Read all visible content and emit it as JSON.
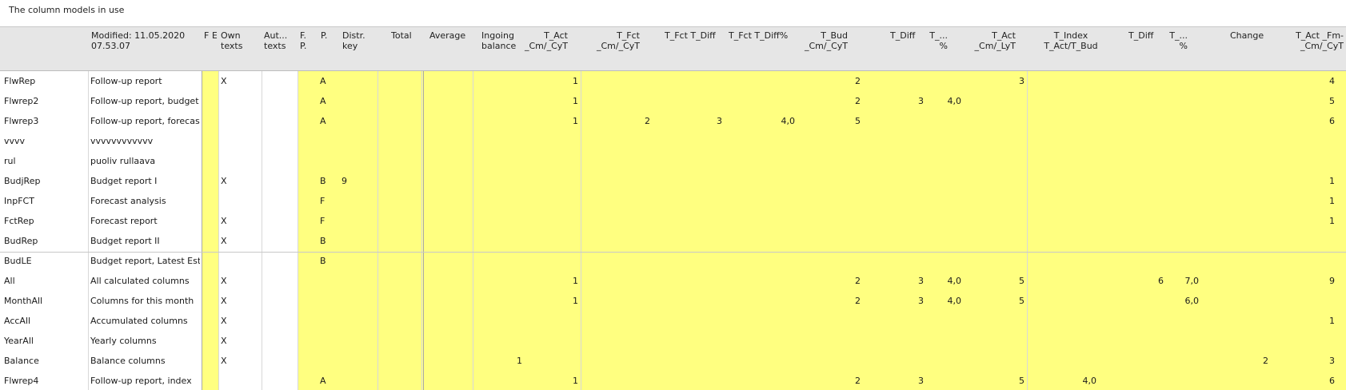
{
  "title": "The column models in use",
  "colors": {
    "highlight": "#ffff80",
    "header_bg": "#e6e6e6",
    "row_line": "#c8c8c8"
  },
  "header": {
    "modified": "Modified: 11.05.2020\n07.53.07",
    "f": "F",
    "e": "E",
    "own_texts": "Own\ntexts",
    "aut_texts": "Aut...\ntexts",
    "fp": "F.\nP.",
    "p": "P.",
    "distr_key": "Distr.\nkey",
    "total": "Total",
    "average": "Average",
    "ingoing_balance": "Ingoing\nbalance",
    "t_act_cm_cyt": "T_Act\n_Cm/_CyT",
    "t_fct_cm_cyt": "T_Fct\n_Cm/_CyT",
    "t_fct_t_diff": "T_Fct T_Diff",
    "t_fct_t_diff_pct": "T_Fct T_Diff%",
    "t_bud_cm_cyt": "T_Bud\n_Cm/_CyT",
    "t_diff_1": "T_Diff",
    "t_pct_1": "T_...\n%",
    "t_act_cm_lyt": "T_Act\n_Cm/_LyT",
    "t_index": "T_Index\nT_Act/T_Bud",
    "t_diff_2": "T_Diff",
    "t_pct_2": "T_...\n%",
    "change": "Change",
    "t_act_fm": "T_Act _Fm-\n_Cm/_CyT"
  },
  "rows": [
    {
      "code": "FlwRep",
      "name": "Follow-up report",
      "own": "X",
      "p": "A",
      "distr": "",
      "ingoing": "",
      "t_act": "1",
      "t_fct": "",
      "fct_diff": "",
      "fct_diff_pct": "",
      "t_bud": "2",
      "t_diff1": "",
      "t_pct1": "",
      "t_act_ly": "3",
      "t_index": "",
      "t_diff2": "",
      "t_pct2": "",
      "change": "",
      "t_act_fm": "4"
    },
    {
      "code": "Flwrep2",
      "name": "Follow-up report, budget",
      "own": "",
      "p": "A",
      "distr": "",
      "ingoing": "",
      "t_act": "1",
      "t_fct": "",
      "fct_diff": "",
      "fct_diff_pct": "",
      "t_bud": "2",
      "t_diff1": "3",
      "t_pct1": "4,0",
      "t_act_ly": "",
      "t_index": "",
      "t_diff2": "",
      "t_pct2": "",
      "change": "",
      "t_act_fm": "5"
    },
    {
      "code": "Flwrep3",
      "name": "Follow-up report, forecast",
      "own": "",
      "p": "A",
      "distr": "",
      "ingoing": "",
      "t_act": "1",
      "t_fct": "2",
      "fct_diff": "3",
      "fct_diff_pct": "4,0",
      "t_bud": "5",
      "t_diff1": "",
      "t_pct1": "",
      "t_act_ly": "",
      "t_index": "",
      "t_diff2": "",
      "t_pct2": "",
      "change": "",
      "t_act_fm": "6"
    },
    {
      "code": "vvvv",
      "name": "vvvvvvvvvvvv",
      "own": "",
      "p": "",
      "distr": "",
      "ingoing": "",
      "t_act": "",
      "t_fct": "",
      "fct_diff": "",
      "fct_diff_pct": "",
      "t_bud": "",
      "t_diff1": "",
      "t_pct1": "",
      "t_act_ly": "",
      "t_index": "",
      "t_diff2": "",
      "t_pct2": "",
      "change": "",
      "t_act_fm": ""
    },
    {
      "code": "rul",
      "name": "puoliv rullaava",
      "own": "",
      "p": "",
      "distr": "",
      "ingoing": "",
      "t_act": "",
      "t_fct": "",
      "fct_diff": "",
      "fct_diff_pct": "",
      "t_bud": "",
      "t_diff1": "",
      "t_pct1": "",
      "t_act_ly": "",
      "t_index": "",
      "t_diff2": "",
      "t_pct2": "",
      "change": "",
      "t_act_fm": ""
    },
    {
      "code": "BudjRep",
      "name": "Budget report I",
      "own": "X",
      "p": "B",
      "distr": "9",
      "ingoing": "",
      "t_act": "",
      "t_fct": "",
      "fct_diff": "",
      "fct_diff_pct": "",
      "t_bud": "",
      "t_diff1": "",
      "t_pct1": "",
      "t_act_ly": "",
      "t_index": "",
      "t_diff2": "",
      "t_pct2": "",
      "change": "",
      "t_act_fm": "1"
    },
    {
      "code": "InpFCT",
      "name": "Forecast analysis",
      "own": "",
      "p": "F",
      "distr": "",
      "ingoing": "",
      "t_act": "",
      "t_fct": "",
      "fct_diff": "",
      "fct_diff_pct": "",
      "t_bud": "",
      "t_diff1": "",
      "t_pct1": "",
      "t_act_ly": "",
      "t_index": "",
      "t_diff2": "",
      "t_pct2": "",
      "change": "",
      "t_act_fm": "1"
    },
    {
      "code": "FctRep",
      "name": "Forecast report",
      "own": "X",
      "p": "F",
      "distr": "",
      "ingoing": "",
      "t_act": "",
      "t_fct": "",
      "fct_diff": "",
      "fct_diff_pct": "",
      "t_bud": "",
      "t_diff1": "",
      "t_pct1": "",
      "t_act_ly": "",
      "t_index": "",
      "t_diff2": "",
      "t_pct2": "",
      "change": "",
      "t_act_fm": "1"
    },
    {
      "code": "BudRep",
      "name": "Budget report II",
      "own": "X",
      "p": "B",
      "distr": "",
      "ingoing": "",
      "t_act": "",
      "t_fct": "",
      "fct_diff": "",
      "fct_diff_pct": "",
      "t_bud": "",
      "t_diff1": "",
      "t_pct1": "",
      "t_act_ly": "",
      "t_index": "",
      "t_diff2": "",
      "t_pct2": "",
      "change": "",
      "t_act_fm": ""
    },
    {
      "code": "BudLE",
      "name": "Budget report, Latest Esti...",
      "own": "",
      "p": "B",
      "distr": "",
      "ingoing": "",
      "t_act": "",
      "t_fct": "",
      "fct_diff": "",
      "fct_diff_pct": "",
      "t_bud": "",
      "t_diff1": "",
      "t_pct1": "",
      "t_act_ly": "",
      "t_index": "",
      "t_diff2": "",
      "t_pct2": "",
      "change": "",
      "t_act_fm": ""
    },
    {
      "code": "All",
      "name": "All calculated columns",
      "own": "X",
      "p": "",
      "distr": "",
      "ingoing": "",
      "t_act": "1",
      "t_fct": "",
      "fct_diff": "",
      "fct_diff_pct": "",
      "t_bud": "2",
      "t_diff1": "3",
      "t_pct1": "4,0",
      "t_act_ly": "5",
      "t_index": "",
      "t_diff2": "6",
      "t_pct2": "7,0",
      "change": "",
      "t_act_fm": "9"
    },
    {
      "code": "MonthAll",
      "name": "Columns for this month",
      "own": "X",
      "p": "",
      "distr": "",
      "ingoing": "",
      "t_act": "1",
      "t_fct": "",
      "fct_diff": "",
      "fct_diff_pct": "",
      "t_bud": "2",
      "t_diff1": "3",
      "t_pct1": "4,0",
      "t_act_ly": "5",
      "t_index": "",
      "t_diff2": "",
      "t_pct2": "6,0",
      "change": "",
      "t_act_fm": ""
    },
    {
      "code": "AccAll",
      "name": "Accumulated columns",
      "own": "X",
      "p": "",
      "distr": "",
      "ingoing": "",
      "t_act": "",
      "t_fct": "",
      "fct_diff": "",
      "fct_diff_pct": "",
      "t_bud": "",
      "t_diff1": "",
      "t_pct1": "",
      "t_act_ly": "",
      "t_index": "",
      "t_diff2": "",
      "t_pct2": "",
      "change": "",
      "t_act_fm": "1"
    },
    {
      "code": "YearAll",
      "name": "Yearly columns",
      "own": "X",
      "p": "",
      "distr": "",
      "ingoing": "",
      "t_act": "",
      "t_fct": "",
      "fct_diff": "",
      "fct_diff_pct": "",
      "t_bud": "",
      "t_diff1": "",
      "t_pct1": "",
      "t_act_ly": "",
      "t_index": "",
      "t_diff2": "",
      "t_pct2": "",
      "change": "",
      "t_act_fm": ""
    },
    {
      "code": "Balance",
      "name": "Balance columns",
      "own": "X",
      "p": "",
      "distr": "",
      "ingoing": "1",
      "t_act": "",
      "t_fct": "",
      "fct_diff": "",
      "fct_diff_pct": "",
      "t_bud": "",
      "t_diff1": "",
      "t_pct1": "",
      "t_act_ly": "",
      "t_index": "",
      "t_diff2": "",
      "t_pct2": "",
      "change": "2",
      "t_act_fm": "3"
    },
    {
      "code": "Flwrep4",
      "name": "Follow-up report, index",
      "own": "",
      "p": "A",
      "distr": "",
      "ingoing": "",
      "t_act": "1",
      "t_fct": "",
      "fct_diff": "",
      "fct_diff_pct": "",
      "t_bud": "2",
      "t_diff1": "3",
      "t_pct1": "",
      "t_act_ly": "5",
      "t_index": "4,0",
      "t_diff2": "",
      "t_pct2": "",
      "change": "",
      "t_act_fm": "6"
    }
  ]
}
